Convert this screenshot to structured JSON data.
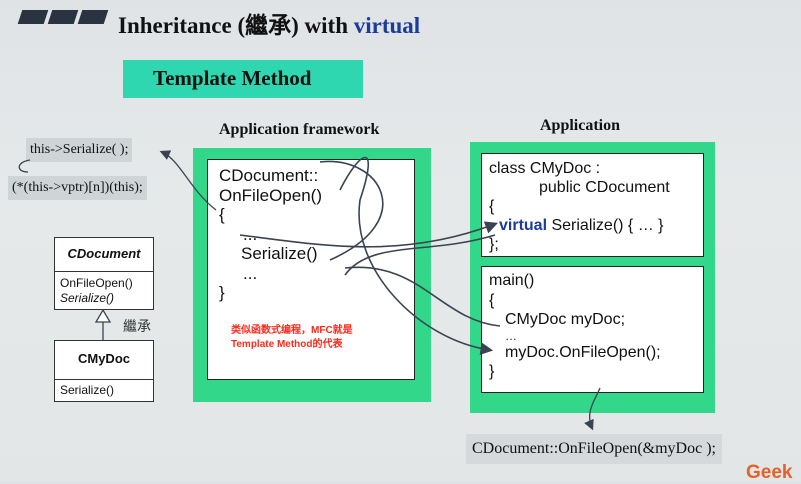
{
  "slide": {
    "title": {
      "prefix": "Inheritance (",
      "cjk": "繼承",
      "mid": ") with ",
      "virtual": "virtual"
    },
    "section_label": "Template Method",
    "framework_heading": "Application framework",
    "application_heading": "Application",
    "annotation": {
      "call_line": "this->Serialize( );",
      "vptr_line": "(*(this->vptr)[n])(this);"
    },
    "uml": {
      "base_class": "CDocument",
      "base_methods": [
        "OnFileOpen()",
        "Serialize()"
      ],
      "inherit_label": "繼承",
      "derived_class": "CMyDoc",
      "derived_methods": [
        "Serialize()"
      ]
    },
    "framework_code": {
      "line1": "CDocument::",
      "line2": "OnFileOpen()",
      "line3": "{",
      "line4": "...",
      "line5": "Serialize()",
      "line6": "...",
      "line7": "}"
    },
    "red_note": {
      "line1": "类似函数式编程，MFC就是",
      "line2": "Template Method的代表"
    },
    "app_class_code": {
      "line1": "class CMyDoc :",
      "line2": "public CDocument",
      "line3": "{",
      "virtual_kw": "virtual",
      "line4_rest": " Serialize() { … }",
      "line5": "};"
    },
    "main_code": {
      "line1": "main()",
      "line2": "{",
      "line3": "CMyDoc myDoc;",
      "line4": "…",
      "line5": "myDoc.OnFileOpen();",
      "line6": "}"
    },
    "bottom_call": "CDocument::OnFileOpen(&myDoc );",
    "watermark": "Geek"
  },
  "colors": {
    "green_frame": "#33d78a",
    "section_band": "#2fd7b0",
    "keyword_blue": "#1b3c9a",
    "note_red": "#ff2a1a",
    "arrow_dark": "#3a4450"
  }
}
